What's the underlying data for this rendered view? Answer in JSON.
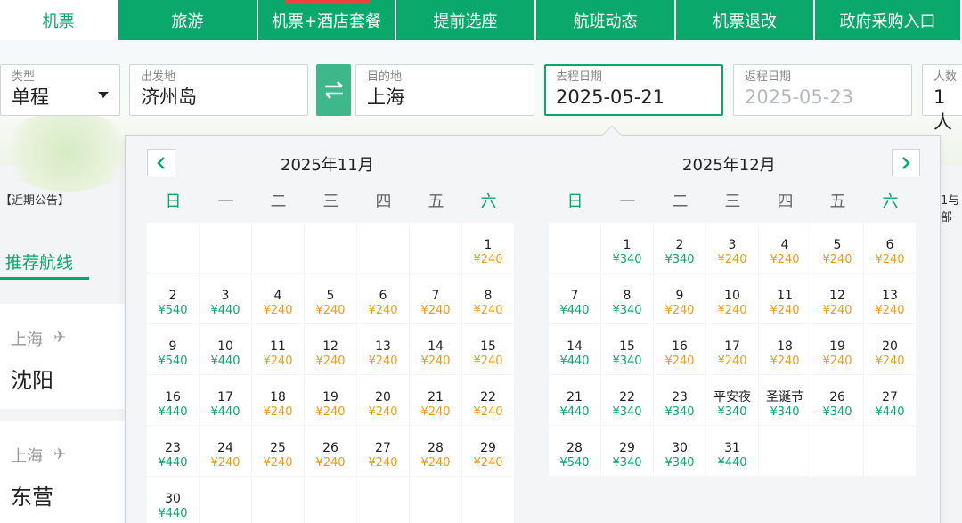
{
  "nav": {
    "tabs": [
      {
        "label": "机票",
        "active": true
      },
      {
        "label": "旅游"
      },
      {
        "label": "机票+酒店套餐",
        "badge": true
      },
      {
        "label": "提前选座"
      },
      {
        "label": "航班动态"
      },
      {
        "label": "机票退改"
      },
      {
        "label": "政府采购入口"
      }
    ]
  },
  "search": {
    "type_label": "类型",
    "type_value": "单程",
    "from_label": "出发地",
    "from_value": "济州岛",
    "to_label": "目的地",
    "to_value": "上海",
    "depart_label": "去程日期",
    "depart_value": "2025-05-21",
    "return_label": "返程日期",
    "return_placeholder": "2025-05-23",
    "pax_label": "人数",
    "pax_value": "1人"
  },
  "side": {
    "notice": "【近期公告】",
    "right_notice": "1与部",
    "recommend_tab": "推荐航线",
    "routes": [
      {
        "from": "上海",
        "to": "沈阳"
      },
      {
        "from": "上海",
        "to": "东营"
      }
    ]
  },
  "colors": {
    "accent": "#0aa86b",
    "price_low": "#0aa86b",
    "price_high": "#f39a13"
  },
  "calendar": {
    "weekdays": [
      "日",
      "一",
      "二",
      "三",
      "四",
      "五",
      "六"
    ],
    "months": [
      {
        "title": "2025年11月",
        "first_weekday": 6,
        "days": [
          {
            "d": "1",
            "p": "¥240",
            "c": "orange"
          },
          {
            "d": "2",
            "p": "¥540",
            "c": "green"
          },
          {
            "d": "3",
            "p": "¥440",
            "c": "green"
          },
          {
            "d": "4",
            "p": "¥240",
            "c": "orange"
          },
          {
            "d": "5",
            "p": "¥240",
            "c": "orange"
          },
          {
            "d": "6",
            "p": "¥240",
            "c": "orange"
          },
          {
            "d": "7",
            "p": "¥240",
            "c": "orange"
          },
          {
            "d": "8",
            "p": "¥240",
            "c": "orange"
          },
          {
            "d": "9",
            "p": "¥540",
            "c": "green"
          },
          {
            "d": "10",
            "p": "¥440",
            "c": "green"
          },
          {
            "d": "11",
            "p": "¥240",
            "c": "orange"
          },
          {
            "d": "12",
            "p": "¥240",
            "c": "orange"
          },
          {
            "d": "13",
            "p": "¥240",
            "c": "orange"
          },
          {
            "d": "14",
            "p": "¥240",
            "c": "orange"
          },
          {
            "d": "15",
            "p": "¥240",
            "c": "orange"
          },
          {
            "d": "16",
            "p": "¥440",
            "c": "green"
          },
          {
            "d": "17",
            "p": "¥440",
            "c": "green"
          },
          {
            "d": "18",
            "p": "¥240",
            "c": "orange"
          },
          {
            "d": "19",
            "p": "¥240",
            "c": "orange"
          },
          {
            "d": "20",
            "p": "¥240",
            "c": "orange"
          },
          {
            "d": "21",
            "p": "¥240",
            "c": "orange"
          },
          {
            "d": "22",
            "p": "¥240",
            "c": "orange"
          },
          {
            "d": "23",
            "p": "¥440",
            "c": "green"
          },
          {
            "d": "24",
            "p": "¥240",
            "c": "orange"
          },
          {
            "d": "25",
            "p": "¥240",
            "c": "orange"
          },
          {
            "d": "26",
            "p": "¥240",
            "c": "orange"
          },
          {
            "d": "27",
            "p": "¥240",
            "c": "orange"
          },
          {
            "d": "28",
            "p": "¥240",
            "c": "orange"
          },
          {
            "d": "29",
            "p": "¥240",
            "c": "orange"
          },
          {
            "d": "30",
            "p": "¥440",
            "c": "green"
          }
        ]
      },
      {
        "title": "2025年12月",
        "first_weekday": 1,
        "days": [
          {
            "d": "1",
            "p": "¥340",
            "c": "green"
          },
          {
            "d": "2",
            "p": "¥340",
            "c": "green"
          },
          {
            "d": "3",
            "p": "¥240",
            "c": "orange"
          },
          {
            "d": "4",
            "p": "¥240",
            "c": "orange"
          },
          {
            "d": "5",
            "p": "¥240",
            "c": "orange"
          },
          {
            "d": "6",
            "p": "¥240",
            "c": "orange"
          },
          {
            "d": "7",
            "p": "¥440",
            "c": "green"
          },
          {
            "d": "8",
            "p": "¥340",
            "c": "green"
          },
          {
            "d": "9",
            "p": "¥240",
            "c": "orange"
          },
          {
            "d": "10",
            "p": "¥240",
            "c": "orange"
          },
          {
            "d": "11",
            "p": "¥240",
            "c": "orange"
          },
          {
            "d": "12",
            "p": "¥240",
            "c": "orange"
          },
          {
            "d": "13",
            "p": "¥240",
            "c": "orange"
          },
          {
            "d": "14",
            "p": "¥440",
            "c": "green"
          },
          {
            "d": "15",
            "p": "¥340",
            "c": "green"
          },
          {
            "d": "16",
            "p": "¥240",
            "c": "orange"
          },
          {
            "d": "17",
            "p": "¥240",
            "c": "orange"
          },
          {
            "d": "18",
            "p": "¥240",
            "c": "orange"
          },
          {
            "d": "19",
            "p": "¥240",
            "c": "orange"
          },
          {
            "d": "20",
            "p": "¥240",
            "c": "orange"
          },
          {
            "d": "21",
            "p": "¥440",
            "c": "green"
          },
          {
            "d": "22",
            "p": "¥340",
            "c": "green"
          },
          {
            "d": "23",
            "p": "¥340",
            "c": "green"
          },
          {
            "d": "平安夜",
            "p": "¥340",
            "c": "green"
          },
          {
            "d": "圣诞节",
            "p": "¥340",
            "c": "green"
          },
          {
            "d": "26",
            "p": "¥340",
            "c": "green"
          },
          {
            "d": "27",
            "p": "¥440",
            "c": "green"
          },
          {
            "d": "28",
            "p": "¥540",
            "c": "green"
          },
          {
            "d": "29",
            "p": "¥340",
            "c": "green"
          },
          {
            "d": "30",
            "p": "¥340",
            "c": "green"
          },
          {
            "d": "31",
            "p": "¥440",
            "c": "green"
          }
        ]
      }
    ]
  }
}
